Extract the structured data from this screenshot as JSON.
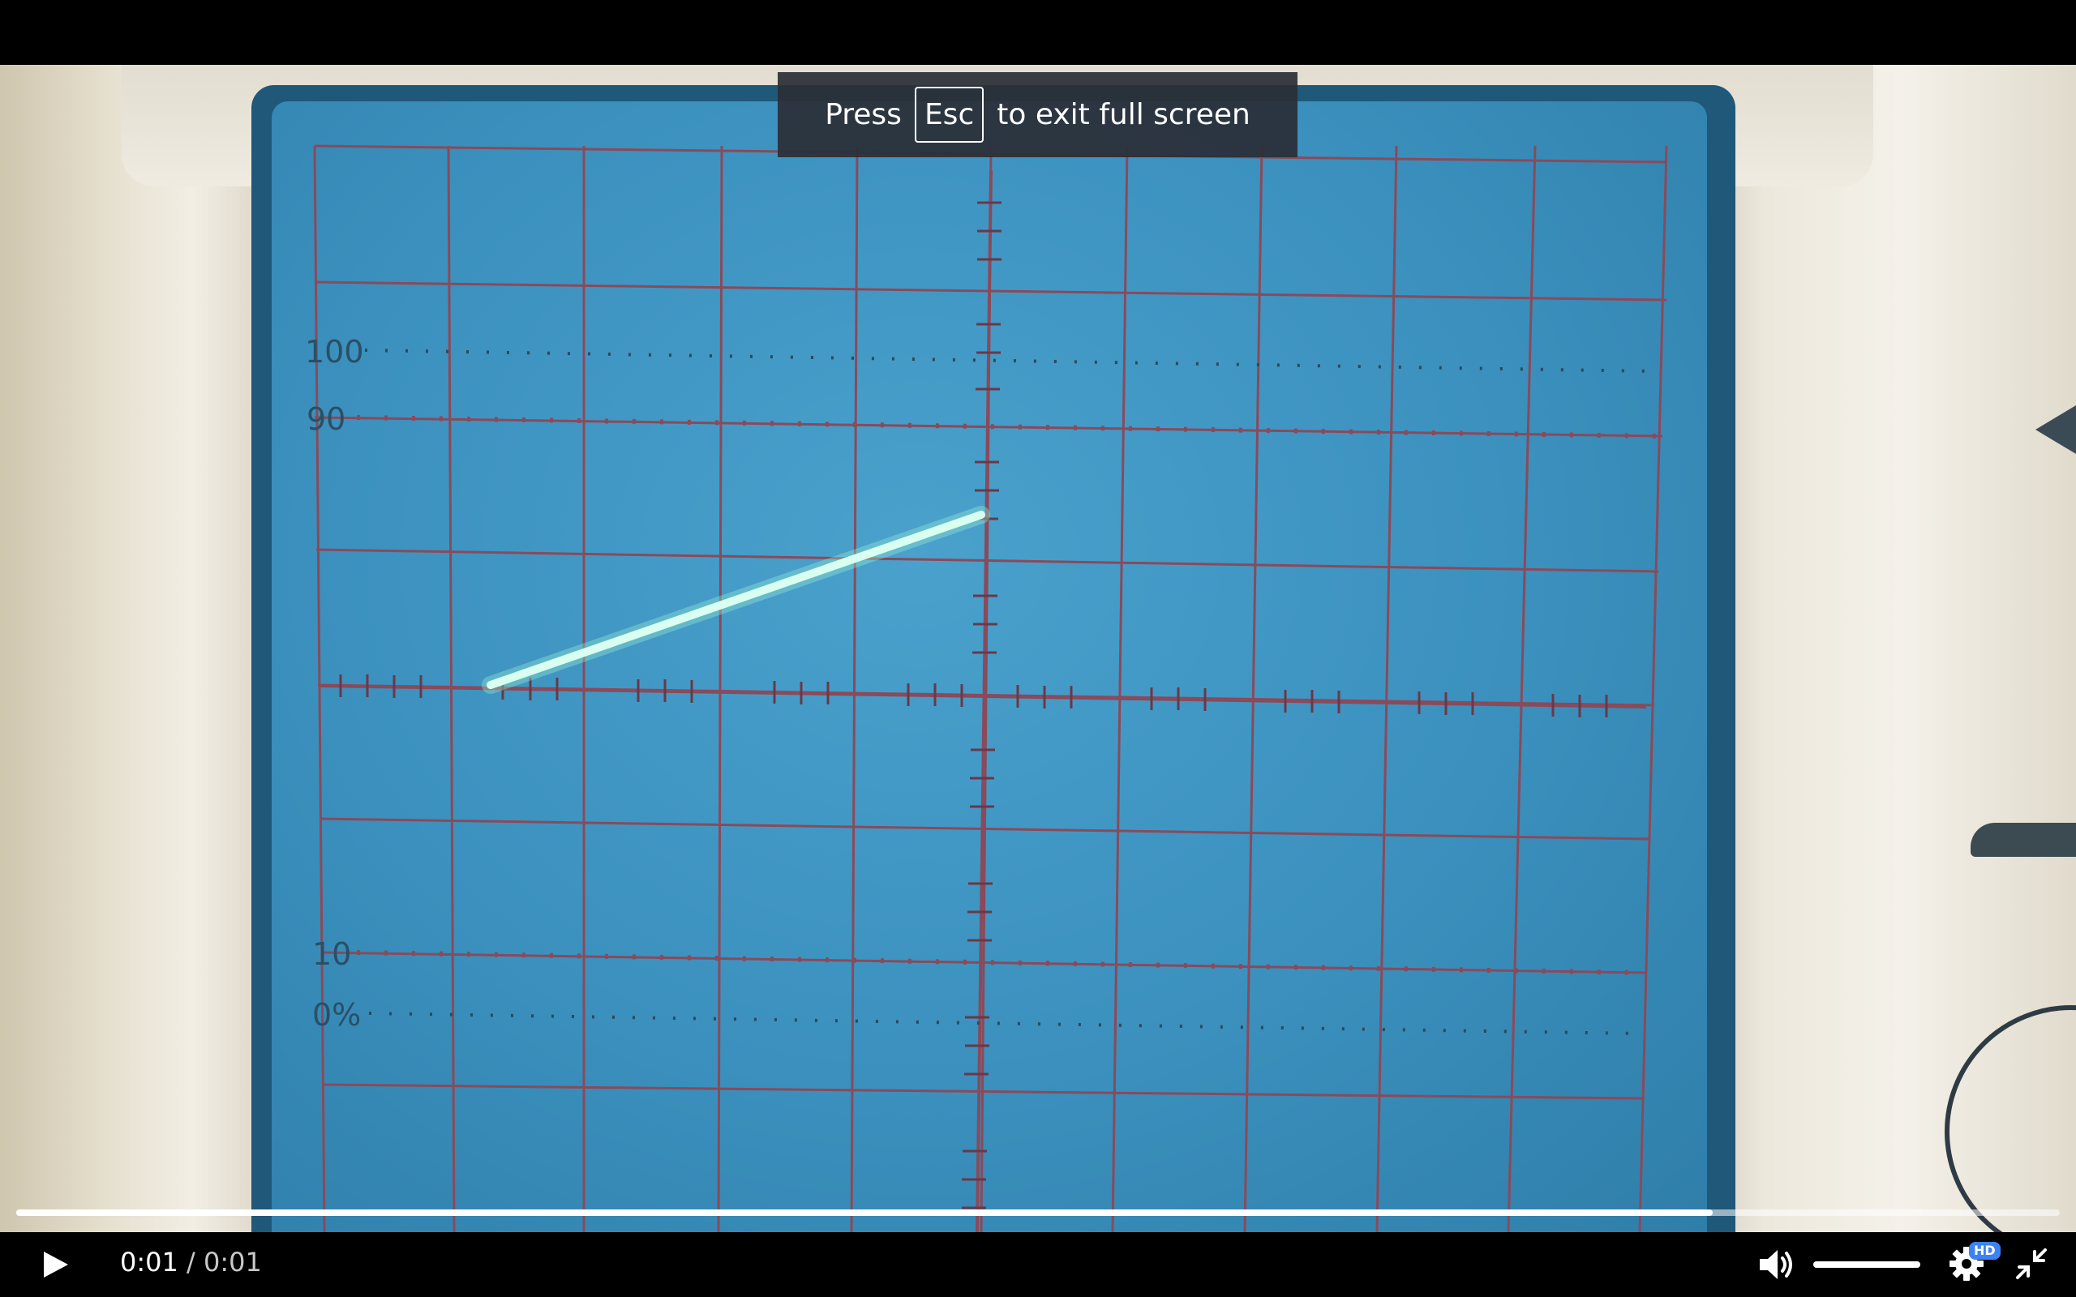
{
  "fullscreen_toast": {
    "press": "Press",
    "key": "Esc",
    "suffix": "to exit full screen"
  },
  "oscilloscope_screen": {
    "labels": {
      "l100": "100",
      "l90": "90",
      "l10": "10",
      "l0": "0%"
    }
  },
  "player": {
    "current_time": "0:01",
    "separator": "/",
    "duration": "0:01",
    "progress_fraction": 0.83,
    "volume_fraction": 1.0,
    "quality_badge": "HD",
    "icons": {
      "play": "play-icon",
      "volume": "volume-icon",
      "settings": "gear-icon",
      "exit_fullscreen": "exit-fullscreen-icon"
    },
    "colors": {
      "badge": "#3b82f6",
      "progress": "#ffffff"
    }
  },
  "colors": {
    "screen": "#3b90bd",
    "trace": "#c8ffe8",
    "grid": "#8a4a5a"
  }
}
